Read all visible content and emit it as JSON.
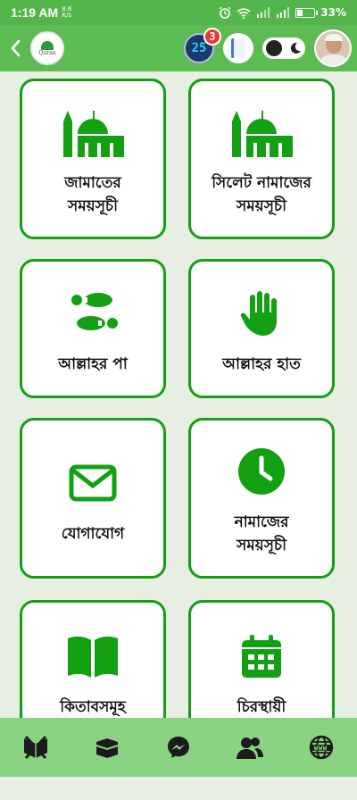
{
  "status_bar": {
    "time": "1:19 AM",
    "net_speed_value": "8.6",
    "net_speed_unit": "K/s",
    "battery": "33%",
    "battery_level": 0.33
  },
  "app_bar": {
    "logo_text": "Quran",
    "calendar_day": "25",
    "notification_count": "3"
  },
  "accent_color": "#13a013",
  "cards": [
    {
      "label_line1": "জামাতের",
      "label_line2": "সময়সূচী",
      "icon": "mosque-icon"
    },
    {
      "label_line1": "সিলেট নামাজের",
      "label_line2": "সময়সূচী",
      "icon": "mosque-icon"
    },
    {
      "label_line1": "আল্লাহর পা",
      "label_line2": "",
      "icon": "footprints-icon"
    },
    {
      "label_line1": "আল্লাহর হাত",
      "label_line2": "",
      "icon": "hand-icon"
    },
    {
      "label_line1": "যোগাযোগ",
      "label_line2": "",
      "icon": "envelope-icon"
    },
    {
      "label_line1": "নামাজের",
      "label_line2": "সময়সূচী",
      "icon": "clock-icon"
    },
    {
      "label_line1": "কিতাবসমূহ",
      "label_line2": "",
      "icon": "book-icon"
    },
    {
      "label_line1": "চিরস্থায়ী",
      "label_line2": "",
      "icon": "calendar-icon"
    }
  ],
  "bottom_nav": [
    "quran-icon",
    "kaaba-icon",
    "messenger-icon",
    "users-icon",
    "www-globe-icon"
  ]
}
